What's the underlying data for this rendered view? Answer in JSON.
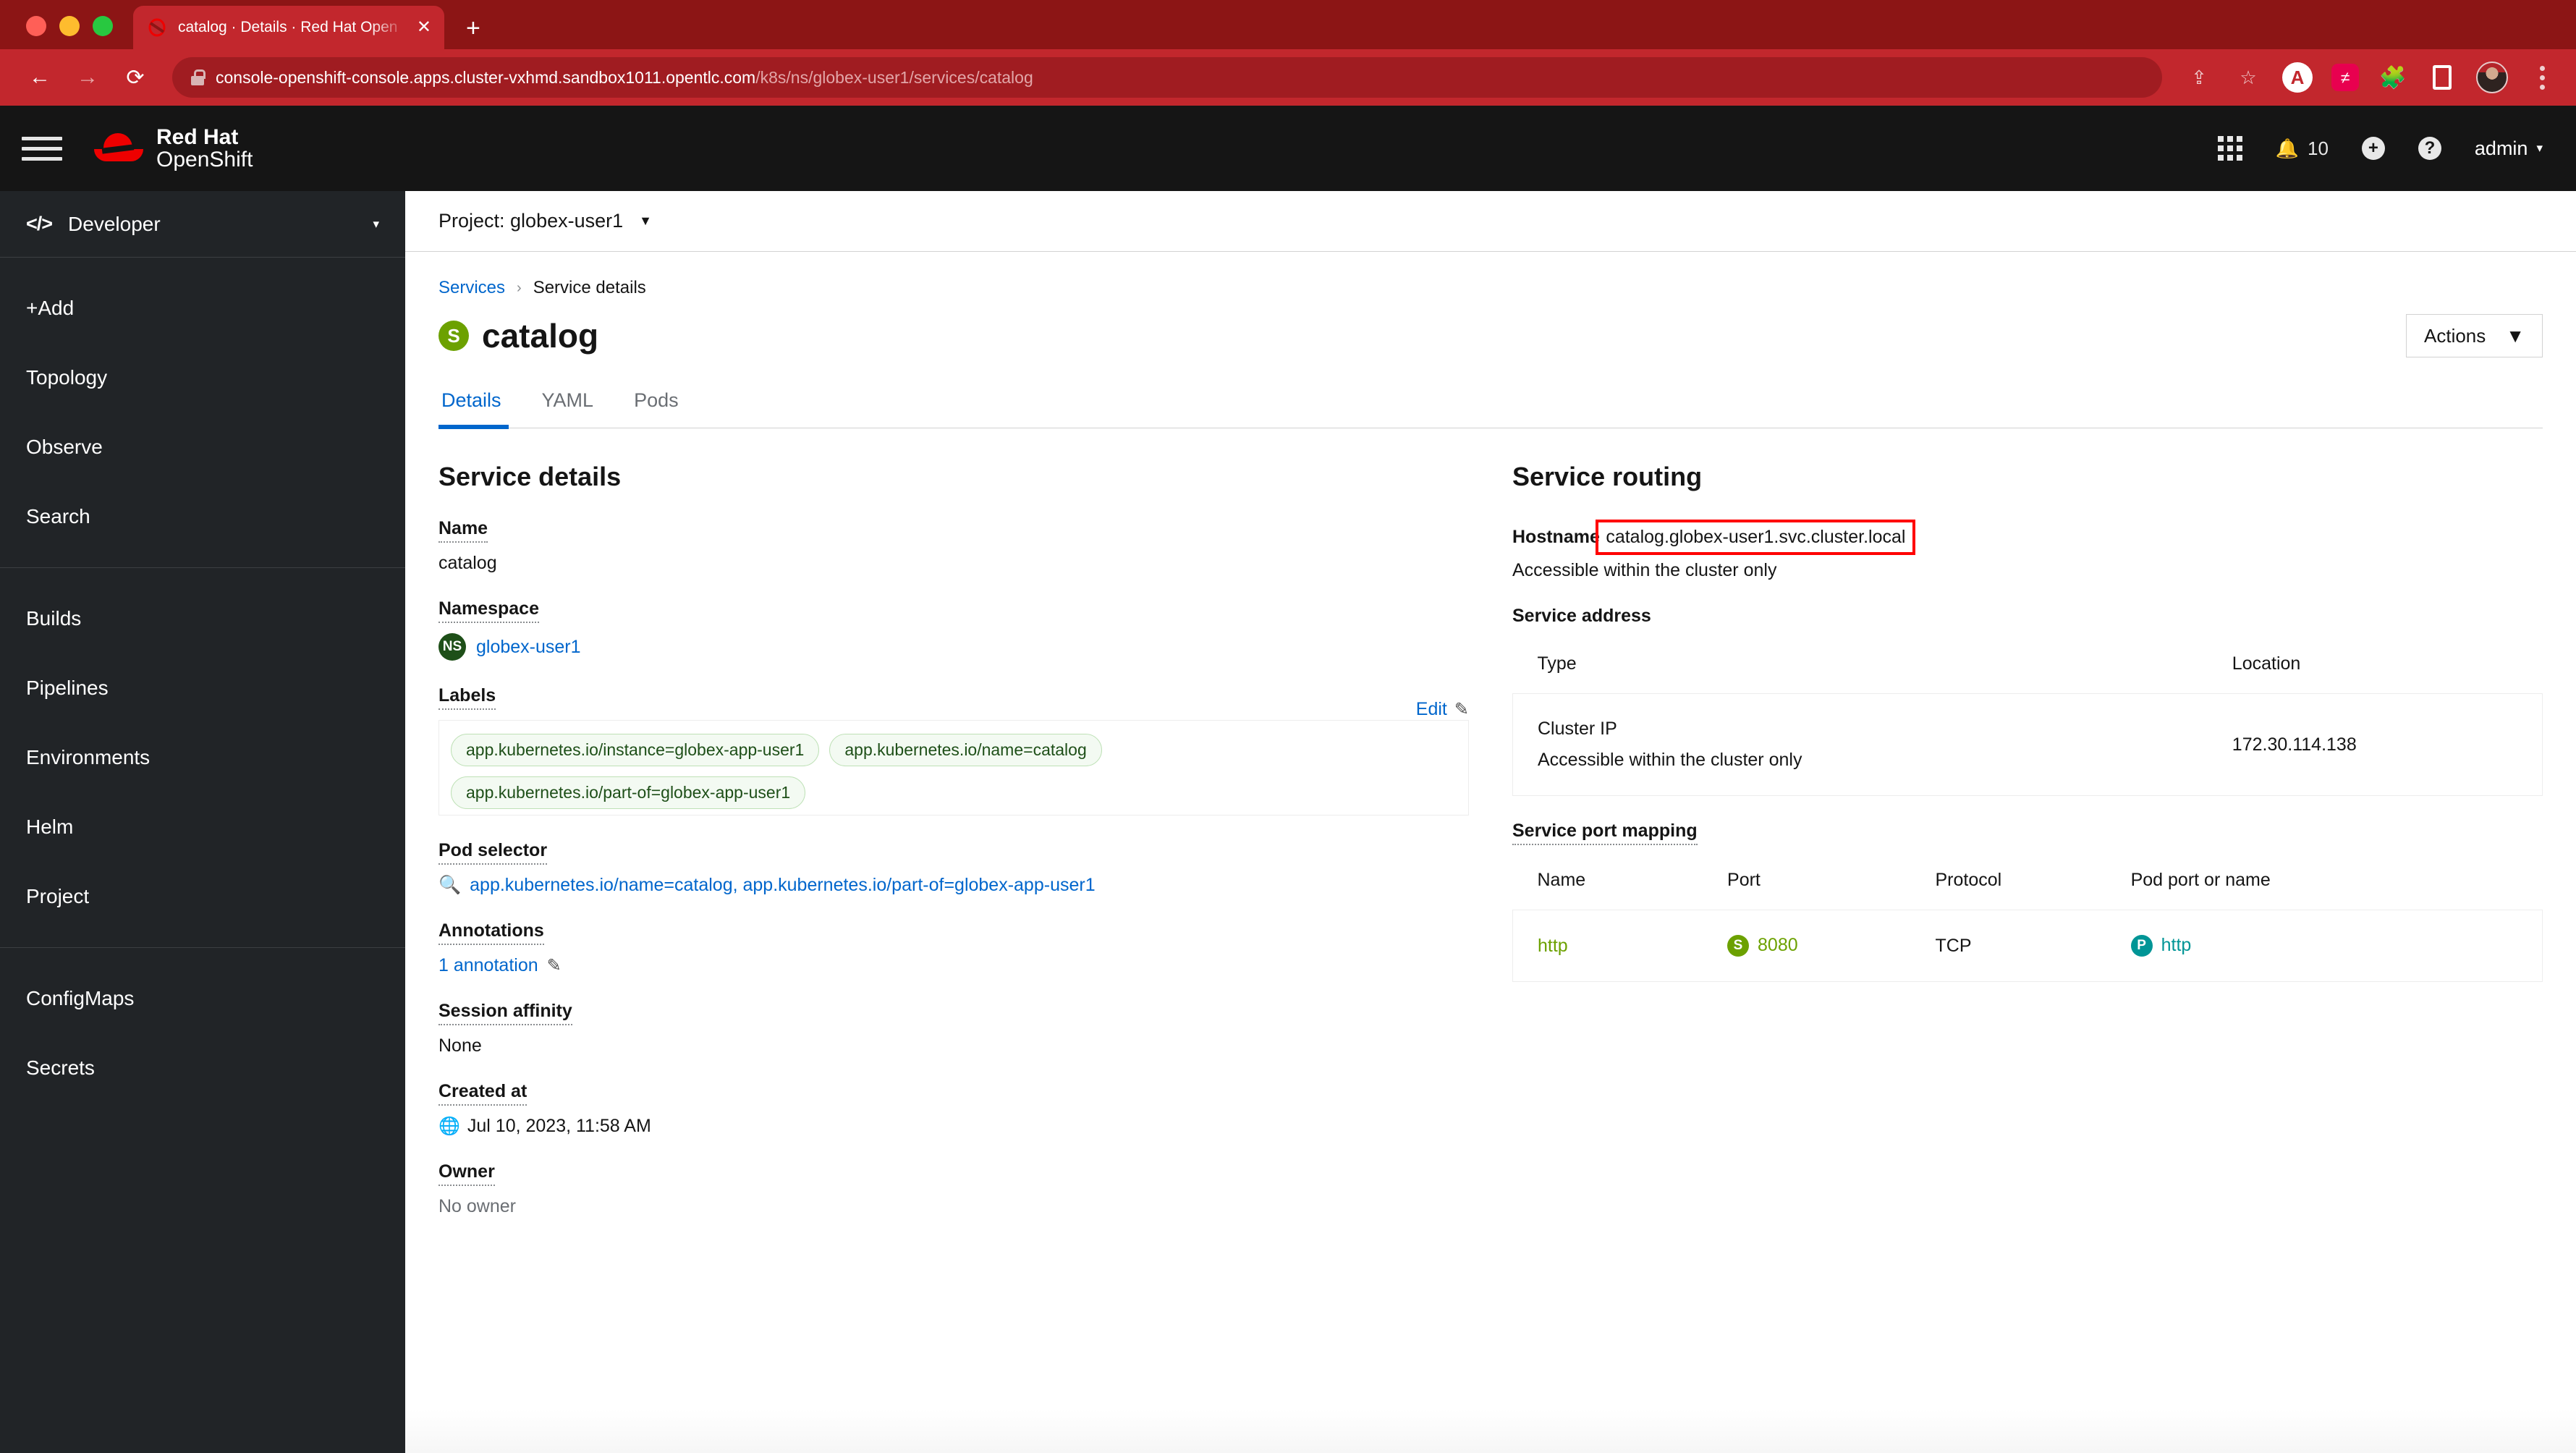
{
  "browser": {
    "tab": {
      "title": "catalog · Details · Red Hat Open",
      "favicon_icon": "openshift-favicon",
      "close_icon": "close-icon"
    },
    "new_tab_icon": "plus-icon",
    "nav": {
      "back_icon": "back-arrow-icon",
      "forward_icon": "forward-arrow-icon",
      "reload_icon": "reload-icon"
    },
    "url": {
      "lock_icon": "lock-icon",
      "domain": "console-openshift-console.apps.cluster-vxhmd.sandbox1011.opentlc.com",
      "path": "/k8s/ns/globex-user1/services/catalog"
    },
    "toolbar_icons": [
      "share-icon",
      "bookmark-star-icon",
      "adobe-acrobat-icon",
      "pink-extension-icon",
      "puzzle-extension-icon",
      "sidebar-panel-icon",
      "profile-avatar-icon",
      "kebab-menu-icon"
    ],
    "accent_color": "#c2272d"
  },
  "masthead": {
    "hamburger_icon": "hamburger-menu-icon",
    "brand_line1": "Red Hat",
    "brand_line2": "OpenShift",
    "apps_icon": "grid-apps-icon",
    "notifications_icon": "bell-icon",
    "notifications_count": "10",
    "add_icon": "plus-circle-icon",
    "help_icon": "question-circle-icon",
    "user": "admin",
    "user_caret_icon": "chevron-down-icon",
    "background": "#151515"
  },
  "sidebar": {
    "perspective": {
      "icon": "code-brackets-icon",
      "label": "Developer",
      "caret_icon": "chevron-down-icon"
    },
    "groups": [
      {
        "items": [
          {
            "label": "+Add"
          },
          {
            "label": "Topology"
          },
          {
            "label": "Observe"
          },
          {
            "label": "Search"
          }
        ]
      },
      {
        "items": [
          {
            "label": "Builds"
          },
          {
            "label": "Pipelines"
          },
          {
            "label": "Environments"
          },
          {
            "label": "Helm"
          },
          {
            "label": "Project"
          }
        ]
      },
      {
        "items": [
          {
            "label": "ConfigMaps"
          },
          {
            "label": "Secrets"
          }
        ]
      }
    ]
  },
  "project_bar": {
    "label": "Project: globex-user1",
    "caret_icon": "chevron-down-icon"
  },
  "breadcrumb": {
    "parent": "Services",
    "separator": "›",
    "current": "Service details"
  },
  "page": {
    "resource_badge": "S",
    "title": "catalog",
    "actions_label": "Actions",
    "actions_caret_icon": "chevron-down-icon"
  },
  "tabs": [
    {
      "label": "Details",
      "active": true
    },
    {
      "label": "YAML",
      "active": false
    },
    {
      "label": "Pods",
      "active": false
    }
  ],
  "service_details": {
    "heading": "Service details",
    "name_label": "Name",
    "name_value": "catalog",
    "namespace_label": "Namespace",
    "namespace_badge": "NS",
    "namespace_value": "globex-user1",
    "labels_label": "Labels",
    "edit_label": "Edit",
    "edit_icon": "pencil-icon",
    "labels": [
      "app.kubernetes.io/instance=globex-app-user1",
      "app.kubernetes.io/name=catalog",
      "app.kubernetes.io/part-of=globex-app-user1"
    ],
    "pod_selector_label": "Pod selector",
    "pod_selector_icon": "search-icon",
    "pod_selector_value": "app.kubernetes.io/name=catalog, app.kubernetes.io/part-of=globex-app-user1",
    "annotations_label": "Annotations",
    "annotations_value": "1 annotation",
    "annotations_edit_icon": "pencil-icon",
    "session_affinity_label": "Session affinity",
    "session_affinity_value": "None",
    "created_at_label": "Created at",
    "created_at_icon": "globe-clock-icon",
    "created_at_value": "Jul 10, 2023, 11:58 AM",
    "owner_label": "Owner",
    "owner_value": "No owner"
  },
  "service_routing": {
    "heading": "Service routing",
    "hostname_label": "Hostname",
    "hostname_value": "catalog.globex-user1.svc.cluster.local",
    "hostname_note": "Accessible within the cluster only",
    "hostname_highlight_color": "#ff0000",
    "address_label": "Service address",
    "address_columns": [
      "Type",
      "Location"
    ],
    "address_rows": [
      {
        "type": "Cluster IP",
        "location": "172.30.114.138",
        "note": "Accessible within the cluster only"
      }
    ],
    "port_mapping_label": "Service port mapping",
    "port_columns": [
      "Name",
      "Port",
      "Protocol",
      "Pod port or name"
    ],
    "port_rows": [
      {
        "name": "http",
        "port_badge": "S",
        "port": "8080",
        "protocol": "TCP",
        "pod_port_badge": "P",
        "pod_port": "http"
      }
    ]
  }
}
